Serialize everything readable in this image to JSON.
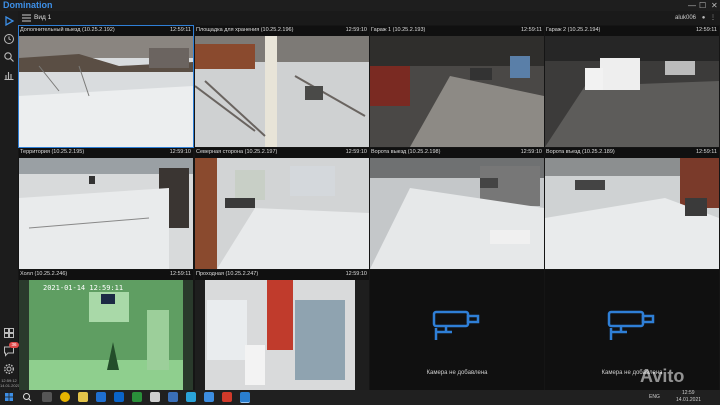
{
  "app": {
    "title": "Domination",
    "user": "aluk006"
  },
  "view": {
    "name": "Вид 1"
  },
  "cameras": [
    {
      "title": "Дополнительный выезд (10.25.2.192)",
      "time": "12:59:11",
      "selected": true
    },
    {
      "title": "Площадка для хранения (10.25.2.196)",
      "time": "12:59:10"
    },
    {
      "title": "Гараж 1 (10.25.2.193)",
      "time": "12:59:11"
    },
    {
      "title": "Гараж 2 (10.25.2.194)",
      "time": "12:59:11"
    },
    {
      "title": "Территория (10.25.2.195)",
      "time": "12:59:10"
    },
    {
      "title": "Северная сторона (10.25.2.197)",
      "time": "12:59:10"
    },
    {
      "title": "Ворота выезд (10.25.2.198)",
      "time": "12:59:10"
    },
    {
      "title": "Ворота въезд (10.25.2.189)",
      "time": "12:59:11"
    },
    {
      "title": "Холл (10.25.2.246)",
      "time": "12:59:11"
    },
    {
      "title": "Проходная (10.25.2.247)",
      "time": "12:59:10"
    }
  ],
  "empty_slots": [
    {
      "label": "Камера не добавлена"
    },
    {
      "label": "Камера не добавлена"
    }
  ],
  "overlays": {
    "hall_timestamp": "2021-01-14 12:59:11"
  },
  "sidebar": {
    "badge": "36",
    "clock_time": "12:59:12",
    "clock_date": "14.01.2021"
  },
  "taskbar": {
    "lang": "ENG",
    "time": "12:59",
    "date": "14.01.2021"
  },
  "watermark": "Avito",
  "colors": {
    "accent": "#2f7fd6",
    "brand": "#3d8fe6",
    "badge": "#e04848"
  }
}
